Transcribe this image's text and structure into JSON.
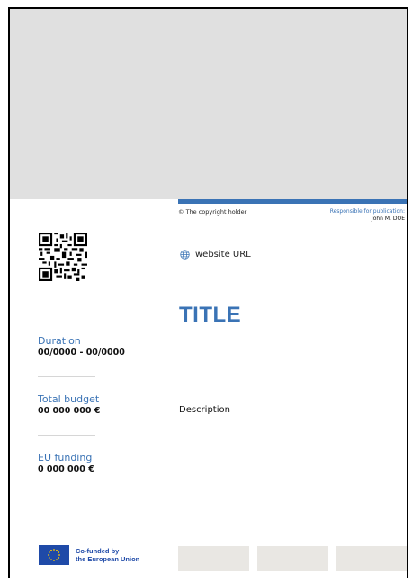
{
  "header": {
    "copyright": "© The copyright holder",
    "responsible_label": "Responsible for publication:",
    "responsible_name": "John M. DOE"
  },
  "website": {
    "text": "website URL",
    "icon": "globe-icon"
  },
  "title": "TITLE",
  "description": "Description",
  "details": {
    "duration_label": "Duration",
    "duration_value": "00/0000 - 00/0000",
    "budget_label": "Total budget",
    "budget_value": "00 000 000 €",
    "funding_label": "EU funding",
    "funding_value": "0 000 000 €"
  },
  "footer": {
    "eu_line1": "Co-funded by",
    "eu_line2": "the European Union"
  },
  "colors": {
    "accent": "#3a73b5",
    "hero": "#e0e0e0",
    "eu_blue": "#1f4aa8",
    "eu_yellow": "#ffcc00"
  }
}
